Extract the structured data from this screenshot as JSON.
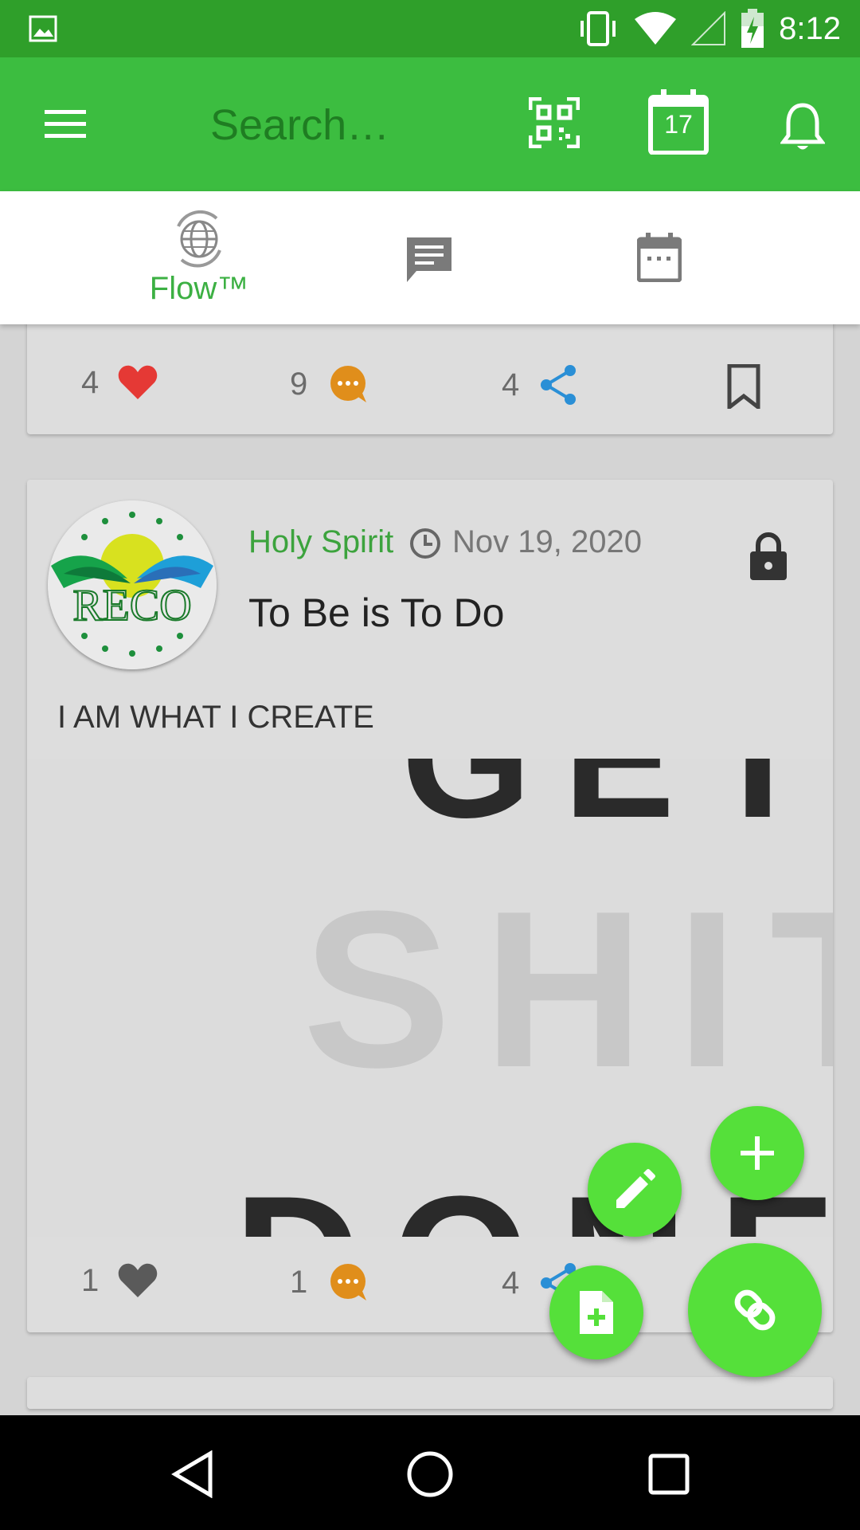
{
  "status_bar": {
    "time": "8:12"
  },
  "app_bar": {
    "search_placeholder": "Search…",
    "calendar_day": "17"
  },
  "tabs": [
    {
      "label": "Flow™",
      "icon": "globe-icon",
      "active": true
    },
    {
      "label": "",
      "icon": "chat-icon",
      "active": false
    },
    {
      "label": "",
      "icon": "calendar-icon",
      "active": false
    }
  ],
  "post_prev": {
    "likes": "4",
    "comments": "9",
    "shares": "4"
  },
  "post": {
    "author": "Holy Spirit",
    "date": "Nov 19, 2020",
    "title": "To  Be is To Do",
    "body": "I AM WHAT I CREATE",
    "avatar_text": "RECO",
    "image_lines": [
      "GET",
      "SHIT",
      "DONE"
    ],
    "likes": "1",
    "comments": "1",
    "shares": "4"
  },
  "colors": {
    "primary": "#3cbd40",
    "status": "#2f9f2a",
    "accent_fab": "#55e03a",
    "heart": "#e53935",
    "comment": "#e08e1b",
    "share": "#2a8fd6"
  }
}
